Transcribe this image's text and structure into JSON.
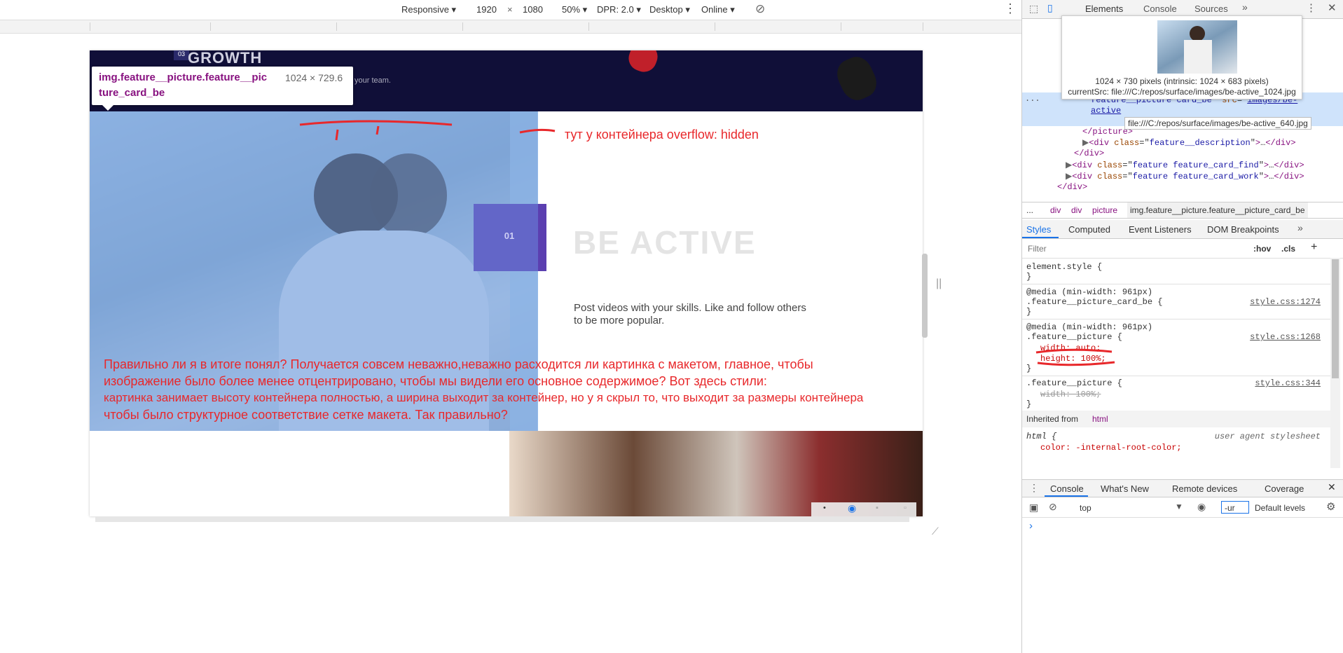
{
  "device_toolbar": {
    "mode": "Responsive",
    "width": "1920",
    "times": "×",
    "height": "1080",
    "zoom": "50%",
    "dpr": "DPR: 2.0",
    "device_type": "Desktop",
    "network": "Online"
  },
  "page": {
    "logo_text": "GROWTH",
    "logo_badge": "03",
    "header_subtext": "your team.",
    "feature_number": "01",
    "feature_title": "BE ACTIVE",
    "feature_desc_line1": "Post videos with your skills. Like and follow others",
    "feature_desc_line2": "to be more popular."
  },
  "inspect_tooltip": {
    "selector_line1": "img.feature__picture.feature__pic",
    "selector_line2": "ture_card_be",
    "size": "1024 × 729.6"
  },
  "annotations": {
    "overflow_note": "тут у контейнера overflow: hidden",
    "question_line1": "Правильно ли я в итоге понял? Получается совсем неважно,неважно расходится ли картинка с макетом, главное, чтобы",
    "question_line2": "изображение было более менее отцентрировано, чтобы мы видели его основное содержимое? Вот здесь стили:",
    "question_line3": "картинка занимает высоту контейнера полностью, а ширина выходит за контейнер, но у я скрыл то, что выходит за размеры контейнера",
    "question_line4": "чтобы было структурное соответствие сетке макета. Так правильно?"
  },
  "devtools": {
    "tabs": [
      "Elements",
      "Console",
      "Sources"
    ],
    "image_preview": {
      "dimensions": "1024 × 730 pixels (intrinsic: 1024 × 683 pixels)",
      "current_src": "currentSrc: file:///C:/repos/surface/images/be-active_1024.jpg"
    },
    "dom": {
      "line1_attrval": "feature__picture card_be",
      "line1_src_a": "images/be-",
      "line1_src_b": "active",
      "src_tooltip": "file:///C:/repos/surface/images/be-active_640.jpg",
      "picture_close": "</picture>",
      "desc_div": "feature__description",
      "div_close": "</div>",
      "card_find": "feature feature_card_find",
      "card_work": "feature feature_card_work",
      "div_close2": "</div>"
    },
    "breadcrumbs": [
      "...",
      "div",
      "div",
      "picture",
      "img.feature__picture.feature__picture_card_be"
    ],
    "styles_tabs": [
      "Styles",
      "Computed",
      "Event Listeners",
      "DOM Breakpoints"
    ],
    "filter_placeholder": "Filter",
    "hov": ":hov",
    "cls": ".cls",
    "plus": "+",
    "rules": {
      "element_style": "element.style {",
      "close": "}",
      "media1": "@media (min-width: 961px)",
      "sel1": ".feature__picture_card_be {",
      "src1": "style.css:1274",
      "media2": "@media (min-width: 961px)",
      "sel2": ".feature__picture {",
      "src2": "style.css:1268",
      "prop_width_auto": "width: auto;",
      "prop_height": "height: 100%;",
      "sel3": ".feature__picture {",
      "src3": "style.css:344",
      "prop_width_100": "width: 100%;",
      "inherited": "Inherited from",
      "inherited_tag": "html",
      "html_sel": "html {",
      "ua": "user agent stylesheet",
      "color_prop": "color: -internal-root-color;"
    },
    "drawer_tabs": [
      "Console",
      "What's New",
      "Remote devices",
      "Coverage"
    ],
    "console_context": "top",
    "console_filter_value": "-ur",
    "default_levels": "Default levels",
    "prompt": "›"
  }
}
